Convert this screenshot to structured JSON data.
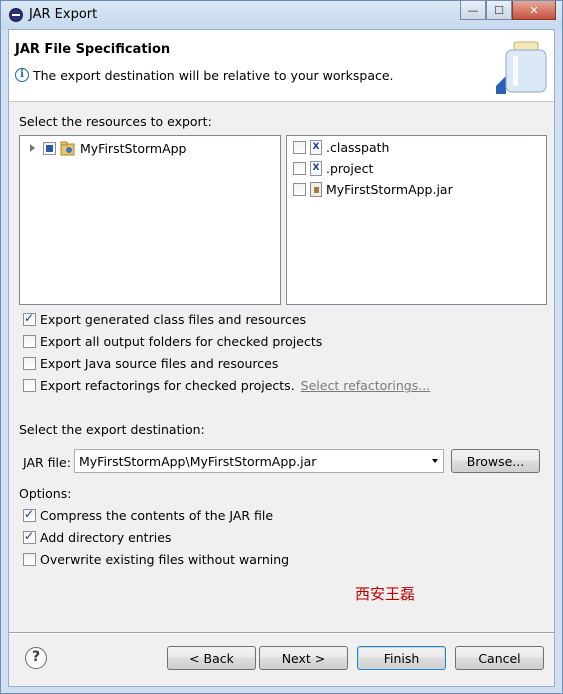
{
  "window": {
    "title": "JAR Export",
    "buttons": {
      "minimize": "—",
      "maximize": "☐",
      "close": "✕"
    }
  },
  "header": {
    "title": "JAR File Specification",
    "message": "The export destination will be relative to your workspace.",
    "info_icon": "i"
  },
  "resources": {
    "label": "Select the resources to export:",
    "tree": [
      {
        "label": "MyFirstStormApp"
      }
    ],
    "files": [
      {
        "label": ".classpath",
        "icon": "x-file-icon",
        "checked": false
      },
      {
        "label": ".project",
        "icon": "x-file-icon",
        "checked": false
      },
      {
        "label": "MyFirstStormApp.jar",
        "icon": "jar-file-icon",
        "checked": false
      }
    ]
  },
  "options_export": [
    {
      "label": "Export generated class files and resources",
      "checked": true
    },
    {
      "label": "Export all output folders for checked projects",
      "checked": false
    },
    {
      "label": "Export Java source files and resources",
      "checked": false
    },
    {
      "label": "Export refactorings for checked projects.",
      "checked": false
    }
  ],
  "select_refactorings_link": "Select refactorings...",
  "destination": {
    "label": "Select the export destination:",
    "jar_file_label": "JAR file:",
    "jar_file_value": "MyFirstStormApp\\MyFirstStormApp.jar",
    "browse_label": "Browse..."
  },
  "options": {
    "label": "Options:",
    "items": [
      {
        "label": "Compress the contents of the JAR file",
        "checked": true
      },
      {
        "label": "Add directory entries",
        "checked": true
      },
      {
        "label": "Overwrite existing files without warning",
        "checked": false
      }
    ]
  },
  "watermark": "西安王磊",
  "footer": {
    "help": "?",
    "back_label": "< Back",
    "next_label": "Next >",
    "finish_label": "Finish",
    "cancel_label": "Cancel"
  },
  "colors": {
    "accent": "#3c7fb1",
    "watermark": "#c00000",
    "link": "#7a7a7a"
  }
}
